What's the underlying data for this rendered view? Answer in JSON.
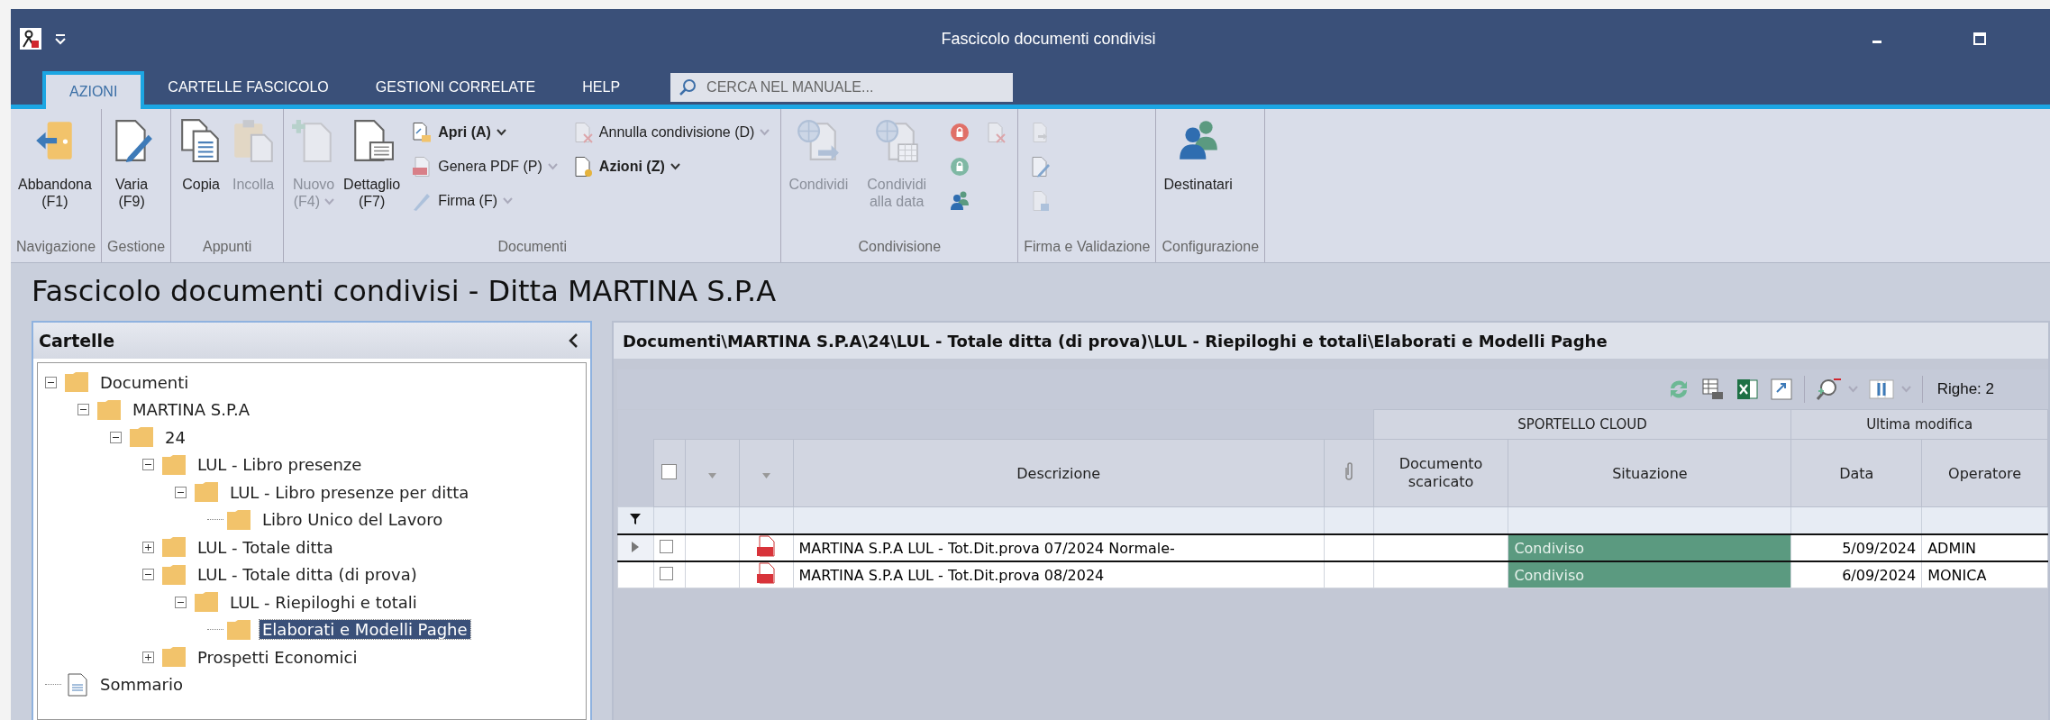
{
  "window": {
    "title": "Fascicolo documenti condivisi"
  },
  "tabs": [
    {
      "label": "AZIONI",
      "selected": true
    },
    {
      "label": "CARTELLE FASCICOLO",
      "selected": false
    },
    {
      "label": "GESTIONI CORRELATE",
      "selected": false
    },
    {
      "label": "HELP",
      "selected": false
    }
  ],
  "search": {
    "placeholder": "CERCA NEL MANUALE..."
  },
  "ribbon": {
    "groups": [
      {
        "label": "Navigazione",
        "items": [
          {
            "kind": "large",
            "label": "Abbandona",
            "shortcut": "(F1)",
            "dropdown": false,
            "disabled": false
          }
        ]
      },
      {
        "label": "Gestione",
        "items": [
          {
            "kind": "large",
            "label": "Varia",
            "shortcut": "(F9)",
            "dropdown": false,
            "disabled": false
          }
        ]
      },
      {
        "label": "Appunti",
        "items": [
          {
            "kind": "large",
            "label": "Copia",
            "dropdown": false,
            "disabled": false
          },
          {
            "kind": "large",
            "label": "Incolla",
            "dropdown": false,
            "disabled": true
          }
        ]
      },
      {
        "label": "Documenti",
        "items": [
          {
            "kind": "large",
            "label": "Nuovo",
            "shortcut": "(F4)",
            "dropdown": true,
            "disabled": true
          },
          {
            "kind": "large",
            "label": "Dettaglio",
            "shortcut": "(F7)",
            "dropdown": false,
            "disabled": false
          },
          {
            "kind": "stack",
            "items": [
              {
                "label": "Apri (A)",
                "dropdown": true,
                "disabled": false
              },
              {
                "label": "Genera PDF (P)",
                "dropdown": true,
                "disabled": true
              },
              {
                "label": "Firma (F)",
                "dropdown": true,
                "disabled": true
              }
            ]
          },
          {
            "kind": "stack",
            "items": [
              {
                "label": "Annulla condivisione (D)",
                "dropdown": true,
                "disabled": true
              },
              {
                "label": "Azioni (Z)",
                "dropdown": true,
                "disabled": false
              }
            ]
          }
        ]
      },
      {
        "label": "Condivisione",
        "items": [
          {
            "kind": "large",
            "label": "Condividi",
            "dropdown": false,
            "disabled": true
          },
          {
            "kind": "large",
            "label": "Condividi alla data",
            "dropdown": false,
            "disabled": true
          },
          {
            "kind": "stack",
            "items": [
              {
                "disabled": false
              },
              {
                "disabled": false
              },
              {
                "disabled": false
              }
            ]
          },
          {
            "kind": "stack",
            "items": [
              {
                "disabled": true
              }
            ]
          }
        ]
      },
      {
        "label": "Firma e Validazione",
        "items": [
          {
            "kind": "stack",
            "items": [
              {
                "disabled": true
              },
              {
                "disabled": true
              },
              {
                "disabled": true
              }
            ]
          }
        ]
      },
      {
        "label": "Configurazione",
        "items": [
          {
            "kind": "large",
            "label": "Destinatari",
            "dropdown": false,
            "disabled": false
          }
        ]
      }
    ]
  },
  "page_title": "Fascicolo documenti condivisi - Ditta MARTINA S.P.A",
  "folders": {
    "title": "Cartelle",
    "items": [
      {
        "kind": "folder",
        "label": "Documenti",
        "expanded": true,
        "selected": false,
        "children": [
          {
            "kind": "folder",
            "label": "MARTINA S.P.A",
            "expanded": true,
            "selected": false,
            "children": [
              {
                "kind": "folder",
                "label": "24",
                "expanded": true,
                "selected": false,
                "children": [
                  {
                    "kind": "folder",
                    "label": "LUL - Libro presenze",
                    "expanded": true,
                    "selected": false,
                    "children": [
                      {
                        "kind": "folder",
                        "label": "LUL - Libro presenze per ditta",
                        "expanded": true,
                        "selected": false,
                        "children": [
                          {
                            "kind": "folder",
                            "label": "Libro Unico del Lavoro",
                            "selected": false
                          }
                        ]
                      }
                    ]
                  },
                  {
                    "kind": "folder",
                    "label": "LUL - Totale ditta",
                    "expanded": false,
                    "selected": false
                  },
                  {
                    "kind": "folder",
                    "label": "LUL - Totale ditta (di prova)",
                    "expanded": true,
                    "selected": false,
                    "children": [
                      {
                        "kind": "folder",
                        "label": "LUL - Riepiloghi e totali",
                        "expanded": true,
                        "selected": false,
                        "children": [
                          {
                            "kind": "folder",
                            "label": "Elaborati e Modelli Paghe",
                            "selected": true
                          }
                        ]
                      }
                    ]
                  },
                  {
                    "kind": "folder",
                    "label": "Prospetti Economici",
                    "expanded": false,
                    "selected": false
                  }
                ]
              }
            ]
          }
        ]
      },
      {
        "kind": "document",
        "label": "Sommario",
        "selected": false
      }
    ]
  },
  "documents": {
    "path": "Documenti\\MARTINA S.P.A\\24\\LUL - Totale ditta (di prova)\\LUL - Riepiloghi e totali\\Elaborati e Modelli Paghe",
    "row_count": "Righe: 2",
    "header_checked": false,
    "column_groups": [
      "SPORTELLO CLOUD",
      "Ultima modifica"
    ],
    "columns": {
      "description": "Descrizione",
      "downloaded": "Documento scaricato",
      "status": "Situazione",
      "date": "Data",
      "operator": "Operatore"
    },
    "rows": [
      {
        "selected": true,
        "checked": false,
        "description": "MARTINA S.P.A LUL - Tot.Dit.prova 07/2024 Normale-",
        "status": "Condiviso",
        "date": "5/09/2024",
        "operator": "ADMIN"
      },
      {
        "selected": false,
        "checked": false,
        "description": "MARTINA S.P.A LUL - Tot.Dit.prova 08/2024",
        "status": "Condiviso",
        "date": "6/09/2024",
        "operator": "MONICA"
      }
    ]
  }
}
